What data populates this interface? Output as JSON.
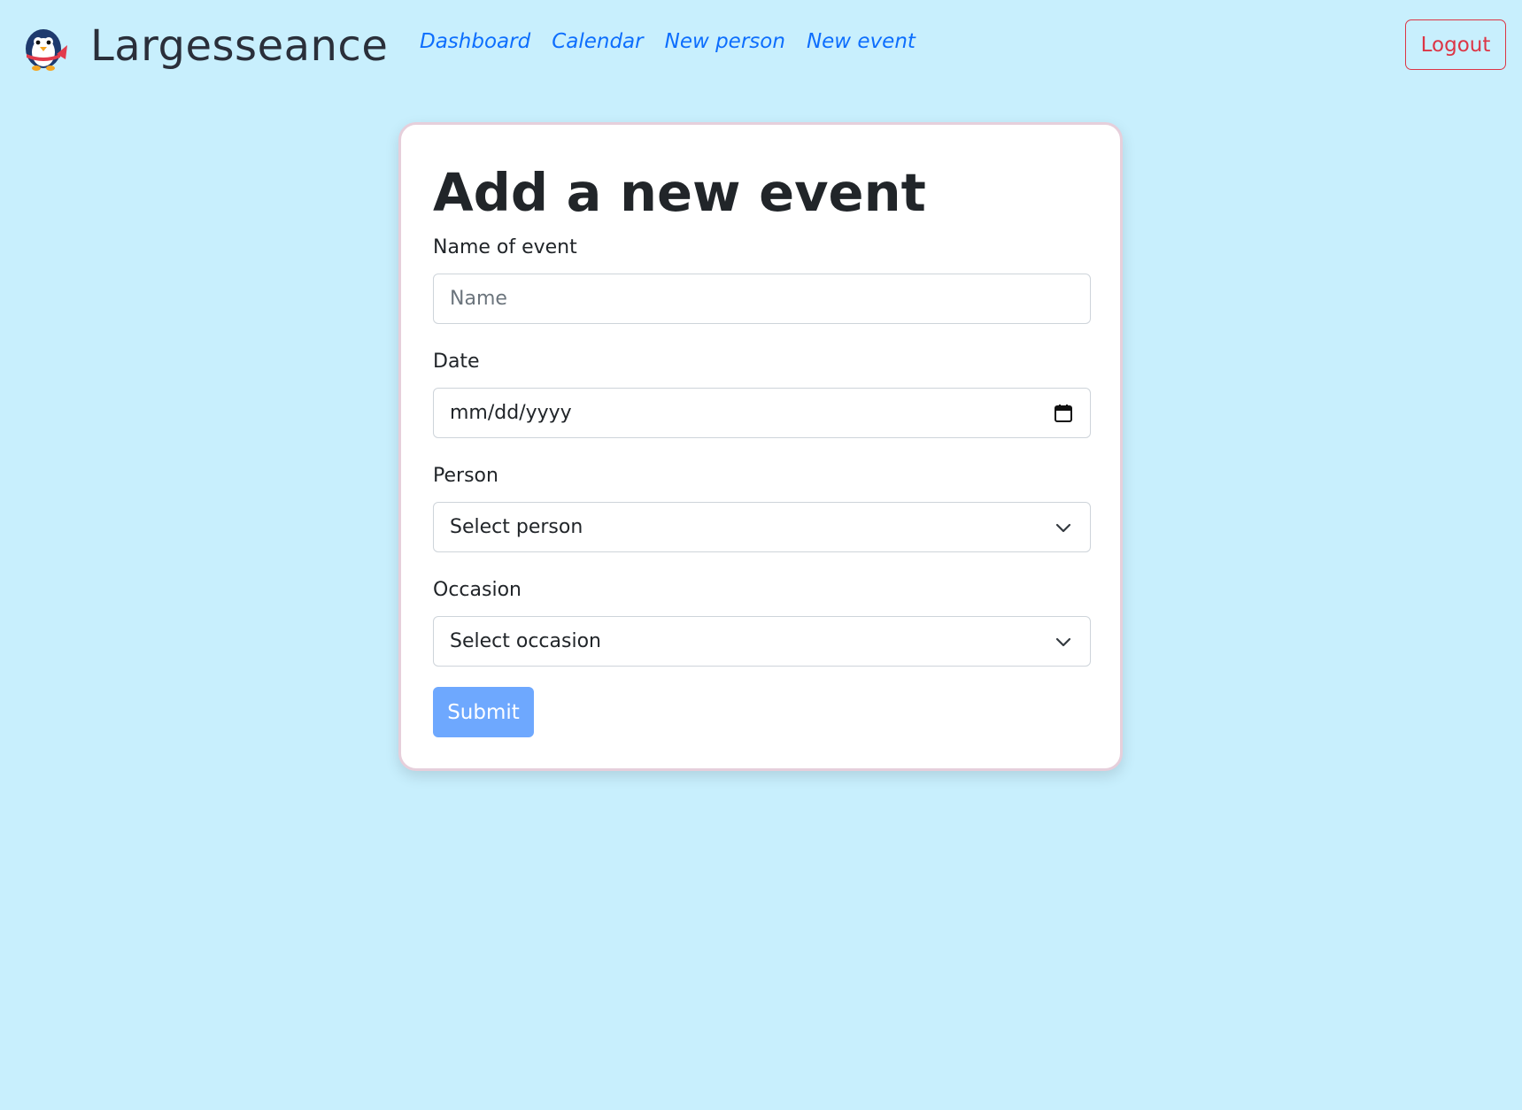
{
  "brand": {
    "name": "Largesseance",
    "logo_icon": "penguin-logo-icon"
  },
  "nav": {
    "links": [
      "Dashboard",
      "Calendar",
      "New person",
      "New event"
    ],
    "link_color": "#0d6efd"
  },
  "logout": {
    "label": "Logout",
    "color": "#dc3545"
  },
  "form": {
    "title": "Add a new event",
    "name_label": "Name of event",
    "name_placeholder": "Name",
    "date_label": "Date",
    "date_value": "mm/dd/yyyy",
    "date_icon": "calendar-icon",
    "person_label": "Person",
    "person_selected": "Select person",
    "occasion_label": "Occasion",
    "occasion_selected": "Select occasion",
    "select_icon": "chevron-down-icon",
    "submit_label": "Submit",
    "submit_color": "#6ea8fe"
  },
  "colors": {
    "background": "#c8effd",
    "card": "#ffffff",
    "card_border": "#e6cfdb"
  }
}
